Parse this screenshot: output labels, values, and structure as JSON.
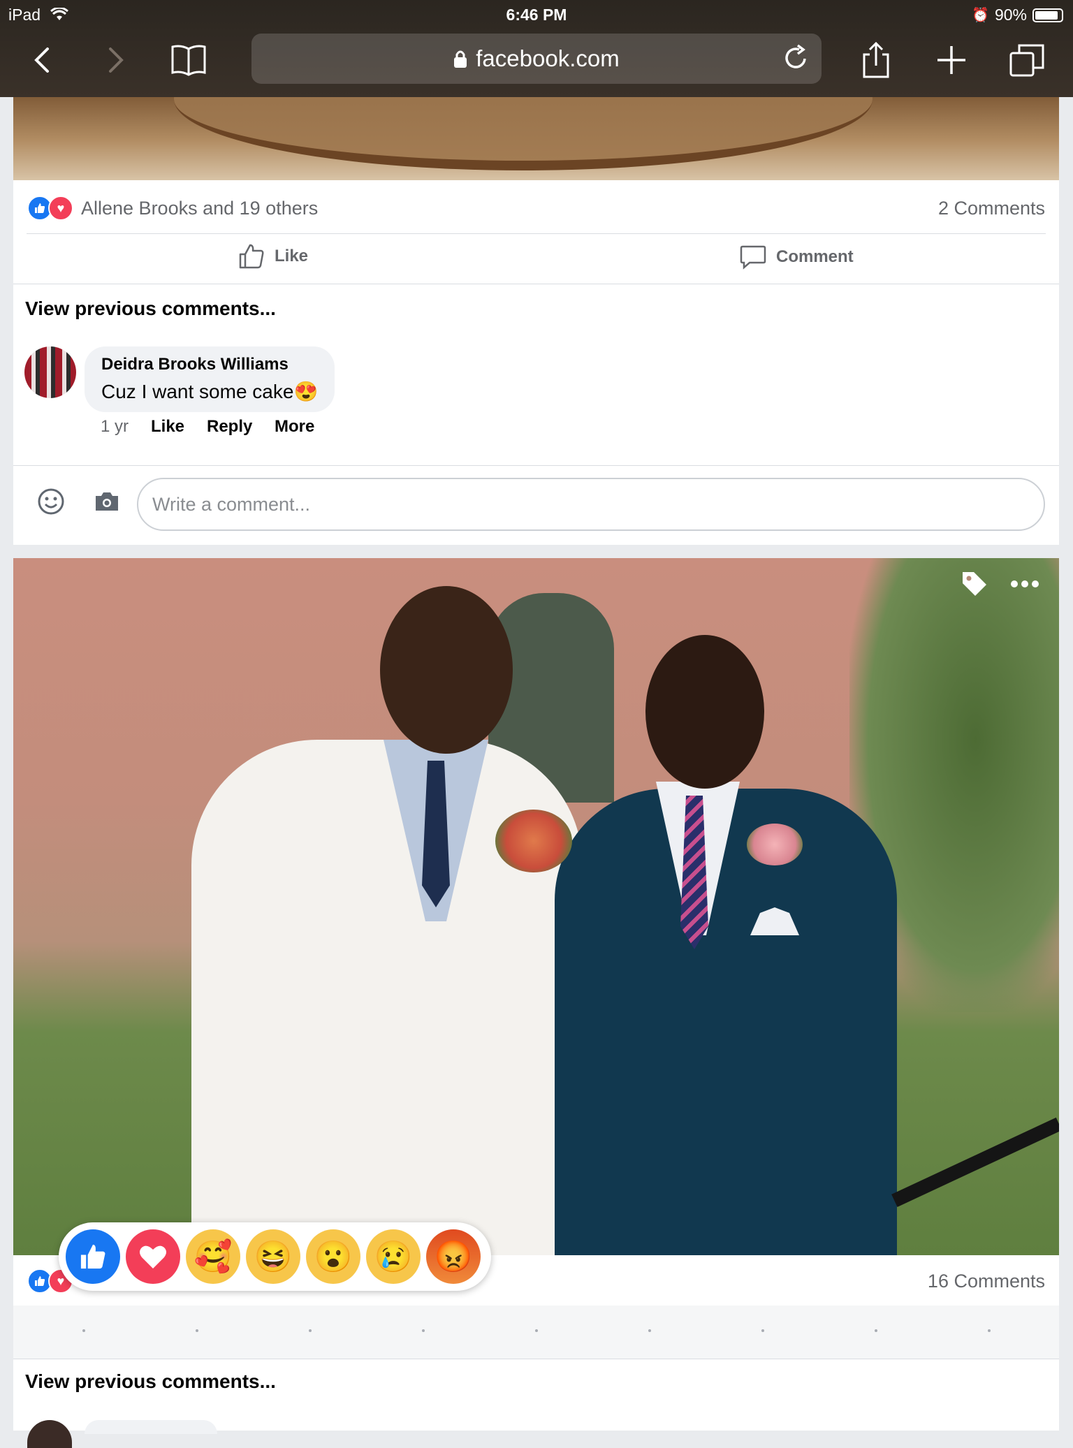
{
  "status_bar": {
    "device": "iPad",
    "time": "6:46 PM",
    "battery": "90%",
    "battery_level": 0.9
  },
  "browser": {
    "url": "facebook.com"
  },
  "post1": {
    "reactions_text": "Allene Brooks and 19 others",
    "comments_count": "2 Comments",
    "like_label": "Like",
    "comment_label": "Comment",
    "view_previous": "View previous comments...",
    "comment": {
      "author": "Deidra Brooks Williams",
      "text": "Cuz I want some cake",
      "emoji": "😍",
      "time": "1 yr",
      "like": "Like",
      "reply": "Reply",
      "more": "More"
    },
    "input_placeholder": "Write a comment..."
  },
  "post2": {
    "comments_count": "16 Comments",
    "view_previous": "View previous comments...",
    "dots": ".",
    "reactions": [
      "like",
      "love",
      "care",
      "haha",
      "wow",
      "sad",
      "angry"
    ],
    "reaction_emojis": {
      "care": "🥰",
      "haha": "😆",
      "wow": "😮",
      "sad": "😢",
      "angry": "😡"
    }
  },
  "colors": {
    "facebook_blue": "#1877f2",
    "love_red": "#f33e58",
    "chrome_bg": "#3a3129"
  }
}
